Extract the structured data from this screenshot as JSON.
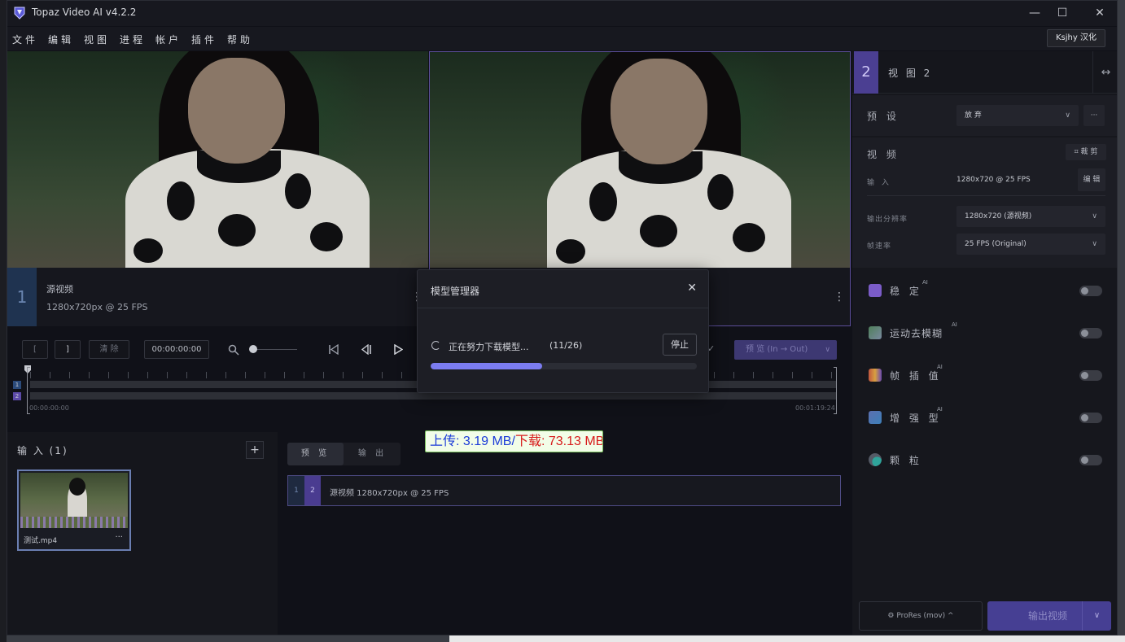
{
  "window": {
    "title": "Topaz Video AI  v4.2.2",
    "minimize": "—",
    "maximize": "☐",
    "close": "✕"
  },
  "menu": {
    "items": [
      "文件",
      "编辑",
      "视图",
      "进程",
      "帐户",
      "插件",
      "帮助"
    ],
    "badge": "Ksjhy 汉化"
  },
  "views": {
    "left": {
      "number": "1",
      "title": "源视频",
      "subtitle": "1280x720px @ 25 FPS"
    },
    "right": {
      "menu": "⋮"
    }
  },
  "timeline": {
    "mark_in": "[",
    "mark_out": "]",
    "clear": "清 除",
    "timecode": "00:00:00:00",
    "preview": "预  览 (In → Out)",
    "start_time": "00:00:00:00",
    "end_time": "00:01:19:24",
    "track1": "1",
    "track2": "2"
  },
  "input_panel": {
    "title": "输 入 (1)",
    "add": "+",
    "file_name": "测试.mp4",
    "more": "···"
  },
  "output_panel": {
    "tabs": [
      "预 览",
      "输 出"
    ],
    "row": {
      "n1": "1",
      "n2": "2",
      "text": "源视频   1280x720px @ 25 FPS"
    }
  },
  "sidebar": {
    "view_number": "2",
    "view_title": "视 图 2",
    "expand": "↔",
    "preset_label": "预 设",
    "preset_value": "放 弃",
    "preset_more": "···",
    "video_label": "视 频",
    "crop": "⌗ 裁 剪",
    "input_label": "输 入",
    "input_value": "1280x720 @ 25 FPS",
    "edit": "编 辑",
    "out_res_label": "输出分辨率",
    "out_res_value": "1280x720 (源视频)",
    "fps_label": "帧速率",
    "fps_value": "25 FPS (Original)",
    "features": [
      {
        "name": "稳 定",
        "ai": "AI",
        "color": "#7b5cc8"
      },
      {
        "name": "运动去模糊",
        "ai": "AI",
        "color": "#4f7f5a"
      },
      {
        "name": "帧 插 值",
        "ai": "AI",
        "color": "#c0553f"
      },
      {
        "name": "增 强 型",
        "ai": "AI",
        "color": "#5b6fb0"
      },
      {
        "name": "颗 粒",
        "ai": "",
        "color": "#2fa39a"
      }
    ],
    "codec": "⚙  ProRes (mov)  ^",
    "export": "输出视频",
    "export_dropdown": "∨"
  },
  "modal": {
    "title": "模型管理器",
    "close": "✕",
    "message": "正在努力下载模型...",
    "count": "(11/26)",
    "stop": "停止",
    "progress": 0.42
  },
  "speed": {
    "upload": "上传: 3.19 MB/",
    "download": "下载: 73.13 MB"
  }
}
